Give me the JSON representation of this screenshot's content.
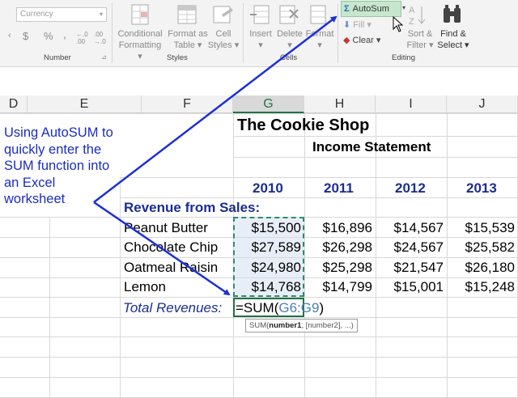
{
  "ribbon": {
    "number_group": {
      "format_value": "Currency",
      "dollar_label": "$",
      "percent_label": "%",
      "comma_label": ",",
      "inc_dec_label": "←.0 .00",
      "dec_dec_label": ".00 →.0",
      "group_label": "Number"
    },
    "styles_group": {
      "conditional_label_1": "Conditional",
      "conditional_label_2": "Formatting",
      "format_table_label_1": "Format as",
      "format_table_label_2": "Table",
      "cell_styles_label_1": "Cell",
      "cell_styles_label_2": "Styles",
      "group_label": "Styles"
    },
    "cells_group": {
      "insert_label": "Insert",
      "delete_label": "Delete",
      "format_label": "Format",
      "group_label": "Cells"
    },
    "editing_group": {
      "autosum_symbol": "Σ",
      "autosum_label": "AutoSum",
      "fill_label": "Fill",
      "clear_label": "Clear",
      "sort_filter_label_1": "Sort &",
      "sort_filter_label_2": "Filter",
      "find_select_label_1": "Find &",
      "find_select_label_2": "Select",
      "group_label": "Editing"
    }
  },
  "columns": [
    "D",
    "E",
    "F",
    "G",
    "H",
    "I",
    "J"
  ],
  "sheet": {
    "title": "The Cookie Shop",
    "subtitle": "Income Statement",
    "years": [
      "2010",
      "2011",
      "2012",
      "2013"
    ],
    "revenue_header": "Revenue from Sales:",
    "rows": [
      {
        "label": "Peanut Butter",
        "values": [
          "$15,500",
          "$16,896",
          "$14,567",
          "$15,539"
        ]
      },
      {
        "label": "Chocolate Chip",
        "values": [
          "$27,589",
          "$26,298",
          "$24,567",
          "$25,582"
        ]
      },
      {
        "label": "Oatmeal  Raisin",
        "values": [
          "$24,980",
          "$25,298",
          "$21,547",
          "$26,180"
        ]
      },
      {
        "label": "Lemon",
        "values": [
          "$14,768",
          "$14,799",
          "$15,001",
          "$15,248"
        ]
      }
    ],
    "total_label": "Total Revenues:",
    "formula_prefix": "=SUM(",
    "formula_ref": "G6:G9",
    "formula_suffix": ")",
    "tooltip_fn": "SUM(",
    "tooltip_arg1": "number1",
    "tooltip_rest": ", [number2], ...)"
  },
  "annotation": "Using AutoSUM to quickly enter the SUM function into an Excel worksheet",
  "colors": {
    "arrow": "#1c2fd6",
    "annotation": "#1b2dbf",
    "header_blue": "#1b2d8f",
    "excel_green": "#217346",
    "autosum_highlight": "#c6e6cd"
  }
}
